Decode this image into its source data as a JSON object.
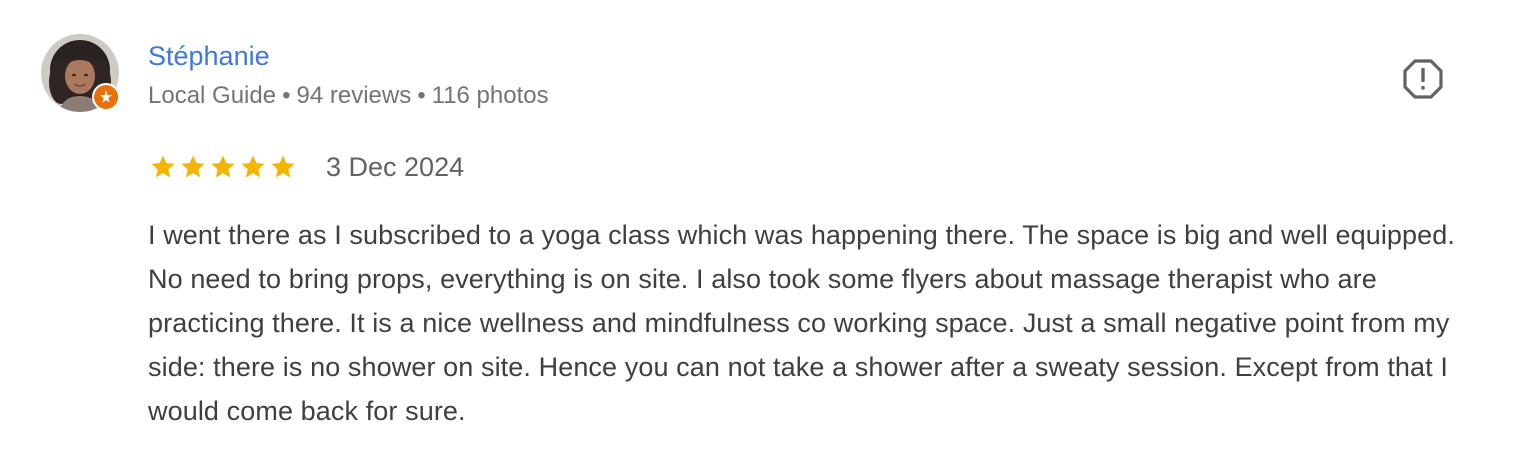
{
  "review": {
    "author": {
      "name": "Stéphanie",
      "level": "Local Guide",
      "reviews": "94 reviews",
      "photos": "116 photos",
      "separator": "•",
      "avatar_icon": "user-photo",
      "badge_icon": "local-guide-star-icon"
    },
    "rating": {
      "stars": 5,
      "max": 5,
      "color": "#f5b400"
    },
    "date": "3 Dec 2024",
    "report_icon": "report-flag-icon",
    "text": "I went there as I subscribed to a yoga class which was happening there. The space is big and well equipped. No need to bring props, everything is on site. I also took some flyers about massage therapist who are practicing there. It is a nice wellness and mindfulness co working space. Just a small negative point from my side: there is no shower on site. Hence you can not take a shower after a sweaty session. Except from that I would come back for sure.",
    "colors": {
      "name": "#4177d8",
      "meta": "#70757a",
      "body": "#3c4043",
      "badge": "#e8710a"
    }
  }
}
